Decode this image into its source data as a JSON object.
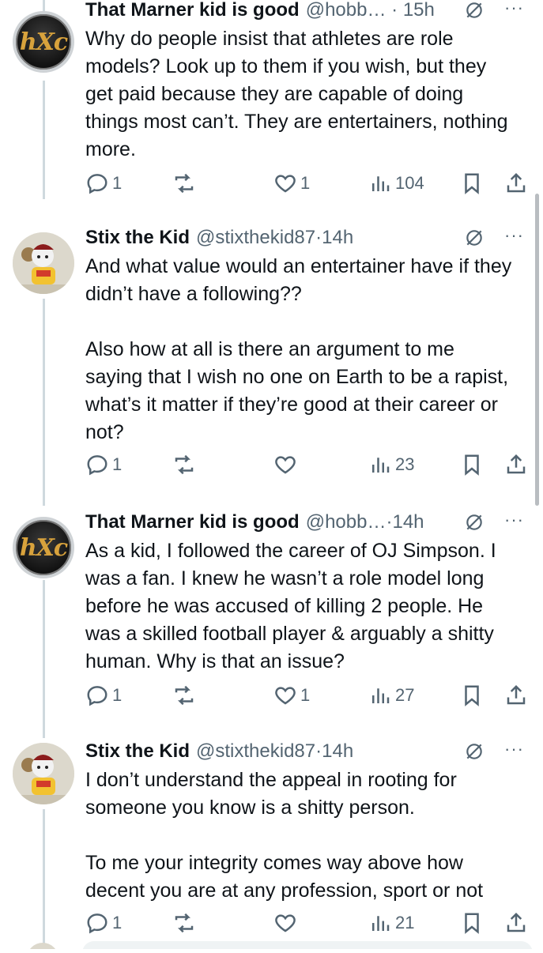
{
  "tweets": [
    {
      "name": "That Marner kid is good",
      "handle": "@hobb…",
      "time": "15h",
      "avatar_text": "hXc",
      "text": "Why do people insist that athletes are role models?  Look up to them if you wish, but they get paid because they are capable of doing things most can’t.  They are entertainers, nothing more.",
      "replies": "1",
      "reposts": "",
      "likes": "1",
      "views": "104"
    },
    {
      "name": "Stix the Kid",
      "handle": "@stixthekid87",
      "time": "14h",
      "text": "And what value would an entertainer have if they didn’t have a following??\n\nAlso how at all is there an argument to me saying that I wish no one on Earth to be a rapist, what’s it matter if they’re good at their career or not?",
      "replies": "1",
      "reposts": "",
      "likes": "",
      "views": "23"
    },
    {
      "name": "That Marner kid is good",
      "handle": "@hobb…",
      "time": "14h",
      "avatar_text": "hXc",
      "text": "As a kid, I followed the career of OJ Simpson.  I was a fan.  I knew he wasn’t a role model long before he was accused of killing 2 people.  He was a skilled football player & arguably a shitty human.  Why is that an issue?",
      "replies": "1",
      "reposts": "",
      "likes": "1",
      "views": "27"
    },
    {
      "name": "Stix the Kid",
      "handle": "@stixthekid87",
      "time": "14h",
      "text": "I don’t understand the appeal in rooting for someone you know is a shitty person.\n\nTo me your integrity comes way above how decent you are at any profession, sport or not",
      "replies": "1",
      "reposts": "",
      "likes": "",
      "views": "21"
    }
  ],
  "separator": "·",
  "more_glyph": "···",
  "colors": {
    "text": "#0f1419",
    "muted": "#536471",
    "line": "#cfd9de"
  }
}
